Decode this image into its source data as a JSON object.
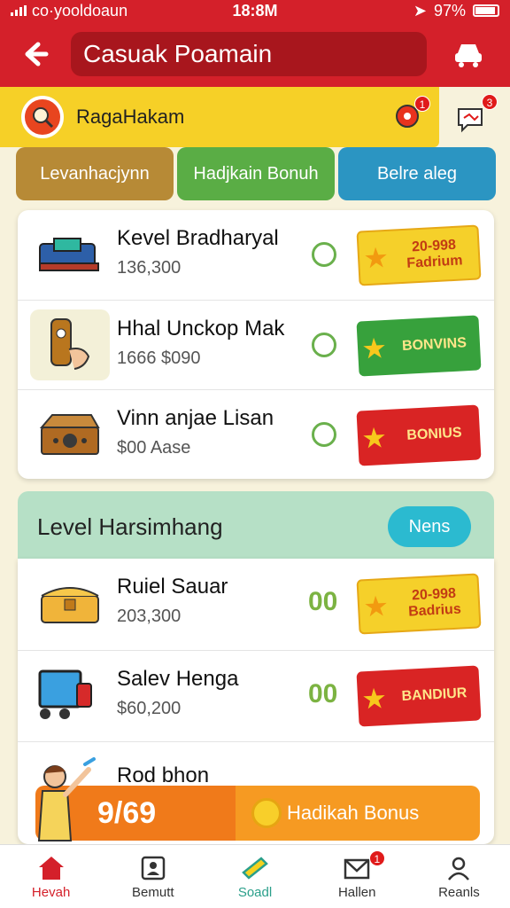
{
  "status": {
    "carrier": "co·yooldoaun",
    "time": "18:8M",
    "battery": "97%"
  },
  "appbar": {
    "title": "Casuak Poamain"
  },
  "profile": {
    "name": "RagaHakam",
    "notif_count": "1",
    "chat_count": "3"
  },
  "tabs": [
    {
      "label": "Levanhacjynn"
    },
    {
      "label": "Hadjkain Bonuh"
    },
    {
      "label": "Belre aleg"
    }
  ],
  "list1": [
    {
      "name": "Kevel Bradharyal",
      "sub": "136,300",
      "reward": "20-998 Fadrium"
    },
    {
      "name": "Hhal Unckop Mak",
      "sub": "1666   $090",
      "reward": "BONVINS"
    },
    {
      "name": "Vinn anjae Lisan",
      "sub": "$00 Aase",
      "reward": "BONIUS"
    }
  ],
  "section": {
    "title": "Level Harsimhang",
    "button": "Nens"
  },
  "list2": [
    {
      "name": "Ruiel Sauar",
      "sub": "203,300",
      "count": "00",
      "reward": "20-998 Badrius"
    },
    {
      "name": "Salev Henga",
      "sub": "$60,200",
      "count": "00",
      "reward": "BANDIUR"
    },
    {
      "name": "Rod bhon",
      "sub": ""
    }
  ],
  "promo": {
    "left": "9/69",
    "right": "Hadikah Bonus"
  },
  "nav": [
    {
      "label": "Hevah",
      "icon": "home-icon"
    },
    {
      "label": "Bemutt",
      "icon": "profile-card-icon"
    },
    {
      "label": "Soadl",
      "icon": "ticket-icon"
    },
    {
      "label": "Hallen",
      "icon": "mail-icon",
      "badge": "1"
    },
    {
      "label": "Reanls",
      "icon": "user-icon"
    }
  ],
  "colors": {
    "primary": "#d4202a",
    "yellow": "#f6d027",
    "green": "#5aad45",
    "blue": "#2b95c2"
  }
}
